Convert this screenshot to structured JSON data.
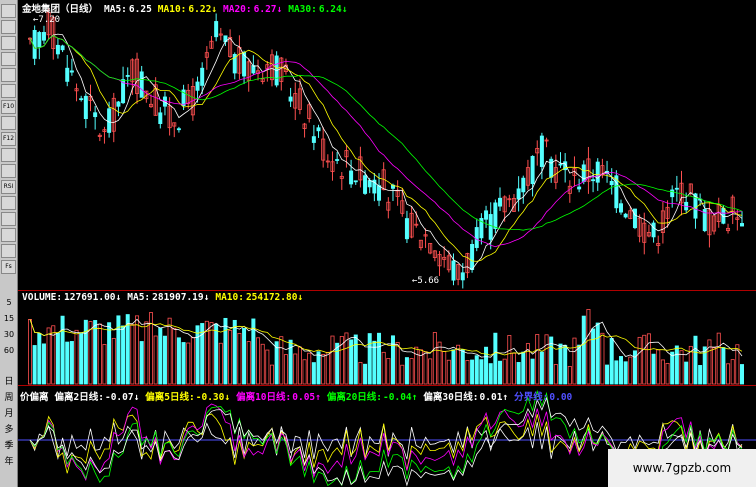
{
  "header": {
    "stock_name": "金地集团（日线）",
    "ma5_label": "MA5:",
    "ma5": "6.25",
    "ma10_label": "MA10:",
    "ma10": "6.22↓",
    "ma20_label": "MA20:",
    "ma20": "6.27↓",
    "ma30_label": "MA30:",
    "ma30": "6.24↓"
  },
  "price_annotations": {
    "high_label": "7.20",
    "low_label": "5.66"
  },
  "volume_header": {
    "vol_label": "VOLUME:",
    "vol": "127691.00↓",
    "ma5_label": "MA5:",
    "ma5": "281907.19↓",
    "ma10_label": "MA10:",
    "ma10": "254172.80↓"
  },
  "volume_axis": [
    "5",
    "15",
    "30",
    "60"
  ],
  "indicator_header": {
    "name": "价偏离",
    "l1_label": "偏离2日线:",
    "l1": "-0.07↓",
    "l2_label": "偏离5日线:",
    "l2": "-0.30↓",
    "l3_label": "偏离10日线:",
    "l3": "0.05↑",
    "l4_label": "偏离20日线:",
    "l4": "-0.04↑",
    "l5_label": "偏离30日线:",
    "l5": "0.01↑",
    "l6_label": "分界线:",
    "l6": "0.00"
  },
  "period_axis": [
    "日",
    "周",
    "月",
    "多",
    "季",
    "年"
  ],
  "toolbar_icons": [
    "cursor-icon",
    "line-icon",
    "chart-icon",
    "grid-icon",
    "text-icon",
    "window-icon",
    "f10-icon",
    "list-icon",
    "f12-icon",
    "zoom-icon",
    "search-icon",
    "rsi-icon",
    "book-icon",
    "move-icon",
    "export-icon",
    "pen-icon",
    "fs-icon"
  ],
  "toolbar_labels": [
    "",
    "",
    "",
    "",
    "",
    "",
    "F10",
    "",
    "F12",
    "",
    "",
    "RSI",
    "",
    "",
    "",
    "",
    "Fs"
  ],
  "watermark": "www.7gpzb.com",
  "colors": {
    "up": "#ff5050",
    "down": "#54ffff",
    "ma5": "#ffffff",
    "ma10": "#ffff00",
    "ma20": "#ff00ff",
    "ma30": "#00ff00",
    "axis": "#b00000",
    "blue": "#5050ff"
  }
}
